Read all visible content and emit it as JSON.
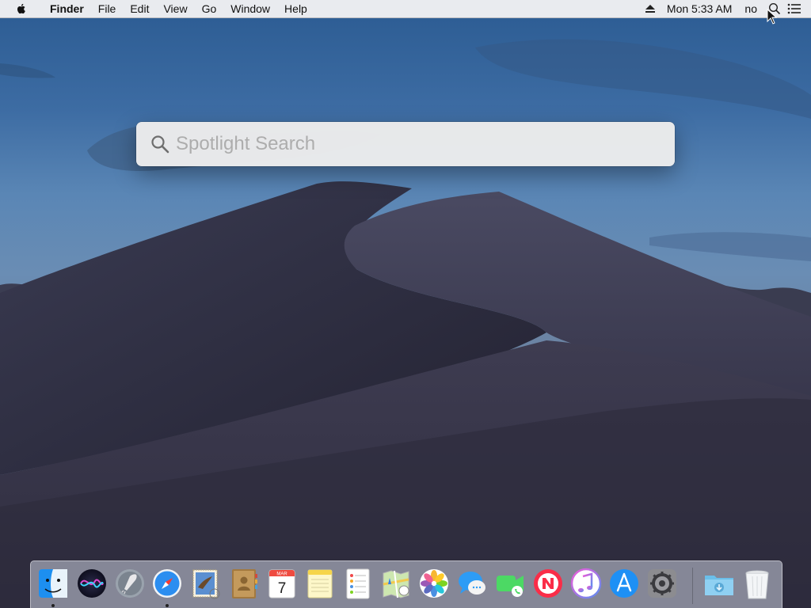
{
  "menubar": {
    "apple_icon": "apple-icon",
    "app_name": "Finder",
    "menus": [
      "File",
      "Edit",
      "View",
      "Go",
      "Window",
      "Help"
    ],
    "status": {
      "eject_icon": "eject-icon",
      "clock": "Mon 5:33 AM",
      "user": "no",
      "spotlight_icon": "magnifier-icon",
      "notification_icon": "list-icon"
    }
  },
  "spotlight": {
    "placeholder": "Spotlight Search",
    "value": "",
    "icon": "magnifier-icon"
  },
  "dock": {
    "apps": [
      {
        "name": "Finder",
        "icon": "finder-icon",
        "running": true
      },
      {
        "name": "Siri",
        "icon": "siri-icon",
        "running": false
      },
      {
        "name": "Launchpad",
        "icon": "rocket-icon",
        "running": false
      },
      {
        "name": "Safari",
        "icon": "compass-icon",
        "running": true
      },
      {
        "name": "Mail",
        "icon": "eagle-stamp-icon",
        "running": false
      },
      {
        "name": "Contacts",
        "icon": "address-book-icon",
        "running": false
      },
      {
        "name": "Calendar",
        "icon": "calendar-icon",
        "running": false,
        "month": "MAR",
        "day": "7"
      },
      {
        "name": "Notes",
        "icon": "notepad-icon",
        "running": false
      },
      {
        "name": "Reminders",
        "icon": "checklist-icon",
        "running": false
      },
      {
        "name": "Maps",
        "icon": "map-icon",
        "running": false
      },
      {
        "name": "Photos",
        "icon": "flower-icon",
        "running": false
      },
      {
        "name": "Messages",
        "icon": "speech-bubble-icon",
        "running": false
      },
      {
        "name": "FaceTime",
        "icon": "video-camera-icon",
        "running": false
      },
      {
        "name": "News",
        "icon": "news-icon",
        "running": false
      },
      {
        "name": "iTunes",
        "icon": "music-note-icon",
        "running": false
      },
      {
        "name": "App Store",
        "icon": "app-store-icon",
        "running": false
      },
      {
        "name": "System Preferences",
        "icon": "gear-icon",
        "running": false
      }
    ],
    "stacks": [
      {
        "name": "Downloads",
        "icon": "downloads-folder-icon"
      },
      {
        "name": "Trash",
        "icon": "trash-icon"
      }
    ]
  },
  "colors": {
    "menubar_bg": "#f0f0f2",
    "spotlight_bg": "#ececec",
    "placeholder": "#adadad",
    "sky_top": "#2f5f95",
    "dune": "#2c2a3c"
  }
}
